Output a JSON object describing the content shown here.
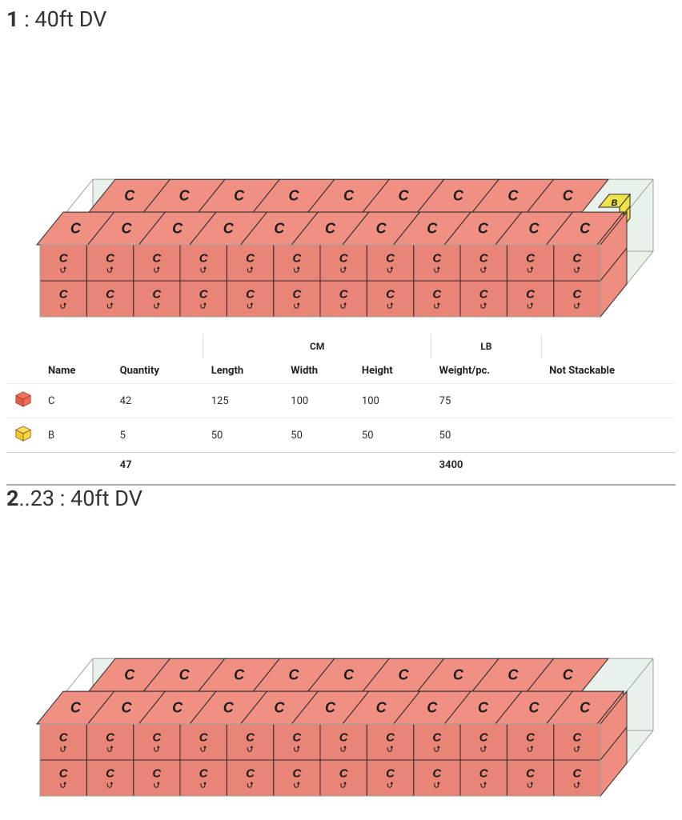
{
  "containers": [
    {
      "title_prefix": "1",
      "title_range": "",
      "title_rest": " : 40ft DV",
      "has_b_stack": true
    },
    {
      "title_prefix": "2",
      "title_range": "..23",
      "title_rest": " : 40ft DV",
      "has_b_stack": false
    }
  ],
  "table": {
    "group_cm": "CM",
    "group_lb": "LB",
    "cols": {
      "name": "Name",
      "quantity": "Quantity",
      "length": "Length",
      "width": "Width",
      "height": "Height",
      "weight": "Weight/pc.",
      "not_stackable": "Not Stackable"
    },
    "rows": [
      {
        "icon": "box-red",
        "name": "C",
        "quantity": "42",
        "length": "125",
        "width": "100",
        "height": "100",
        "weight": "75",
        "not_stackable": ""
      },
      {
        "icon": "box-yellow",
        "name": "B",
        "quantity": "5",
        "length": "50",
        "width": "50",
        "height": "50",
        "weight": "50",
        "not_stackable": ""
      }
    ],
    "totals": {
      "quantity": "47",
      "weight": "3400"
    }
  },
  "colors": {
    "box_c_top": "#f09083",
    "box_c_front": "#e98577",
    "box_c_side": "#ef8d7f",
    "box_b_top": "#f2e24a",
    "box_b_front": "#e9d840",
    "box_b_side": "#efe046",
    "container_line": "#9aa39b",
    "container_fill": "#e9f2ea",
    "stroke": "#3b3b3b"
  }
}
